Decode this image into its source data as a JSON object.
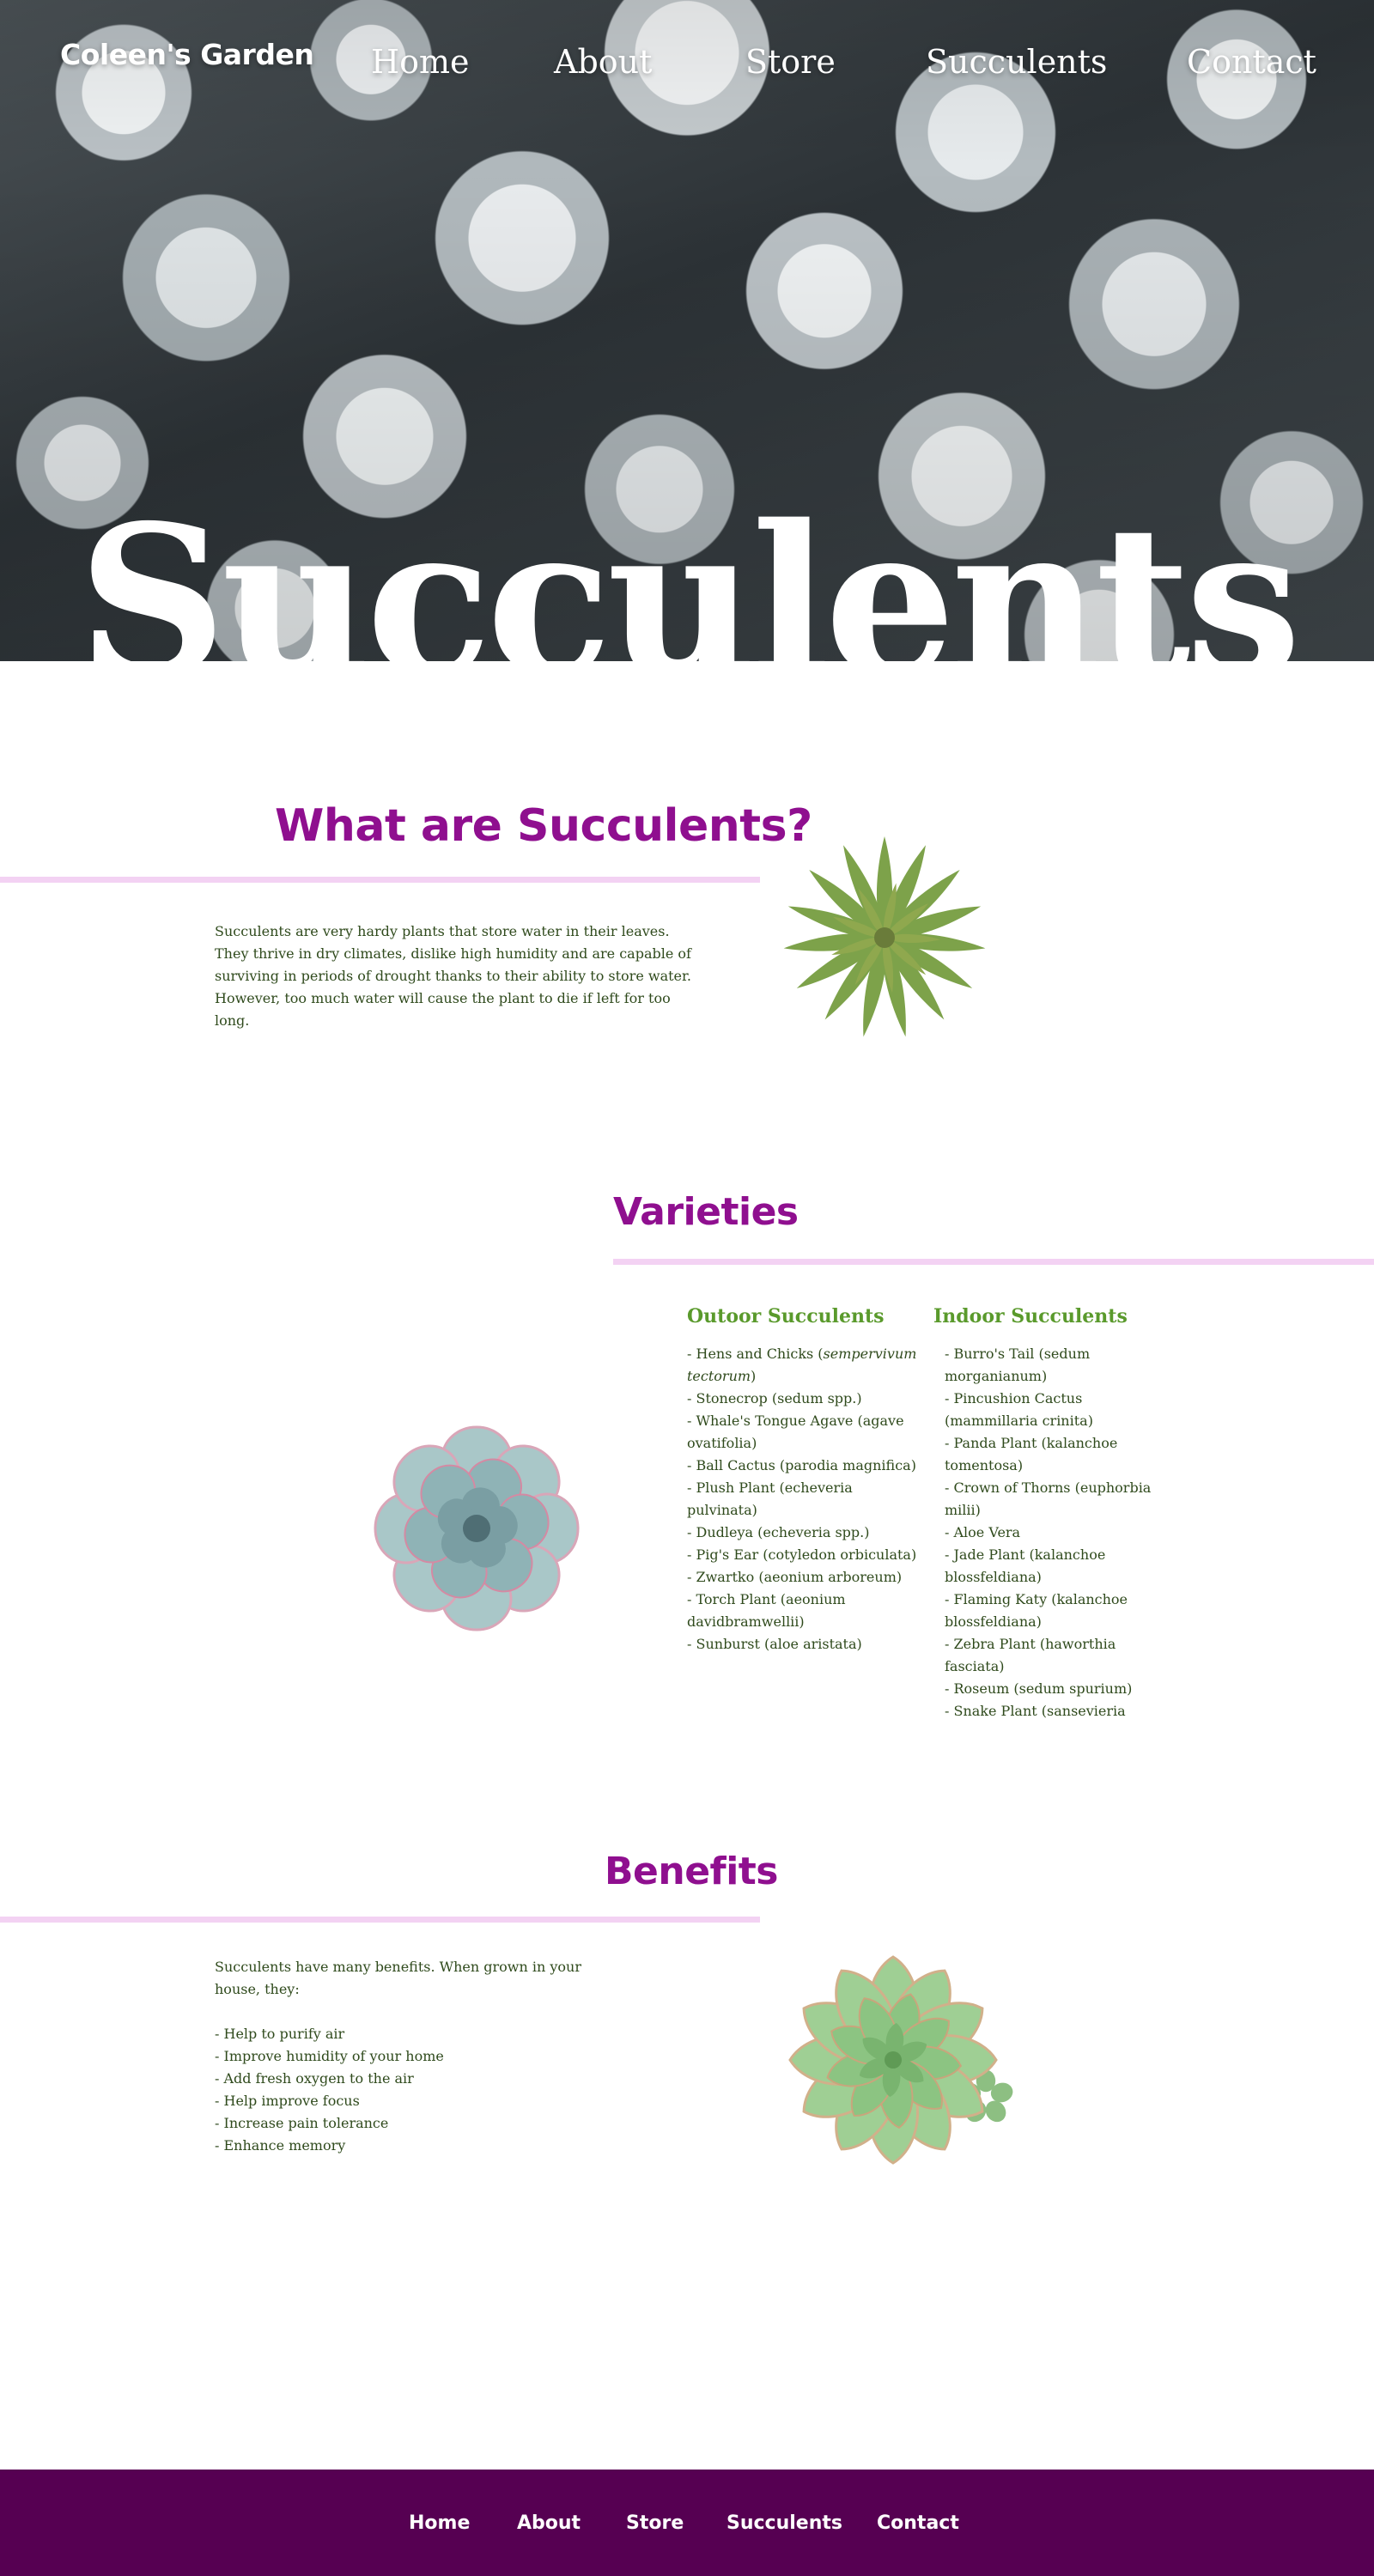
{
  "brand": "Coleen's Garden",
  "nav": [
    "Home",
    "About",
    "Store",
    "Succulents",
    "Contact"
  ],
  "hero_title": "Succulents",
  "what": {
    "title": "What are Succulents?",
    "text": "Succulents are very hardy plants that store water in their leaves. They thrive in dry climates, dislike high humidity and are capable of surviving in periods of drought thanks to their ability to store water. However, too much water will cause the plant to die if left for too long."
  },
  "varieties": {
    "title": "Varieties",
    "outdoor_title": "Outoor Succulents",
    "outdoor": [
      "- Hens and Chicks (sempervivum tectorum)",
      "- Stonecrop (sedum spp.)",
      "- Whale's Tongue Agave (agave ovatifolia)",
      "- Ball Cactus (parodia magnifica)",
      "- Plush Plant (echeveria pulvinata)",
      "- Dudleya (echeveria spp.)",
      "- Pig's Ear (cotyledon orbiculata)",
      "- Zwartko (aeonium arboreum)",
      "- Torch Plant (aeonium davidbramwellii)",
      "- Sunburst (aloe aristata)"
    ],
    "indoor_title": "Indoor Succulents",
    "indoor": [
      " - Burro's Tail (sedum morganianum)",
      " - Pincushion Cactus (mammillaria crinita)",
      " - Panda Plant (kalanchoe tomentosa)",
      " - Crown of Thorns (euphorbia milii)",
      " - Aloe Vera",
      " - Jade Plant (kalanchoe blossfeldiana)",
      " - Flaming Katy (kalanchoe blossfeldiana)",
      " - Zebra Plant (haworthia fasciata)",
      " - Roseum (sedum spurium)",
      " - Snake Plant (sansevieria"
    ]
  },
  "benefits": {
    "title": "Benefits",
    "intro": "Succulents have many benefits. When grown in your house, they:",
    "items": [
      "- Help to purify air",
      "- Improve humidity of your home",
      "- Add fresh oxygen to the air",
      "- Help improve focus",
      "- Increase pain tolerance",
      "- Enhance memory"
    ]
  },
  "footer_nav": [
    "Home",
    "About",
    "Store",
    "Succulents",
    "Contact"
  ],
  "colors": {
    "heading": "#8f0f8f",
    "rule": "#f3d2f3",
    "body": "#2f4a1c",
    "subhead": "#5a9a2c",
    "footer": "#560052"
  }
}
